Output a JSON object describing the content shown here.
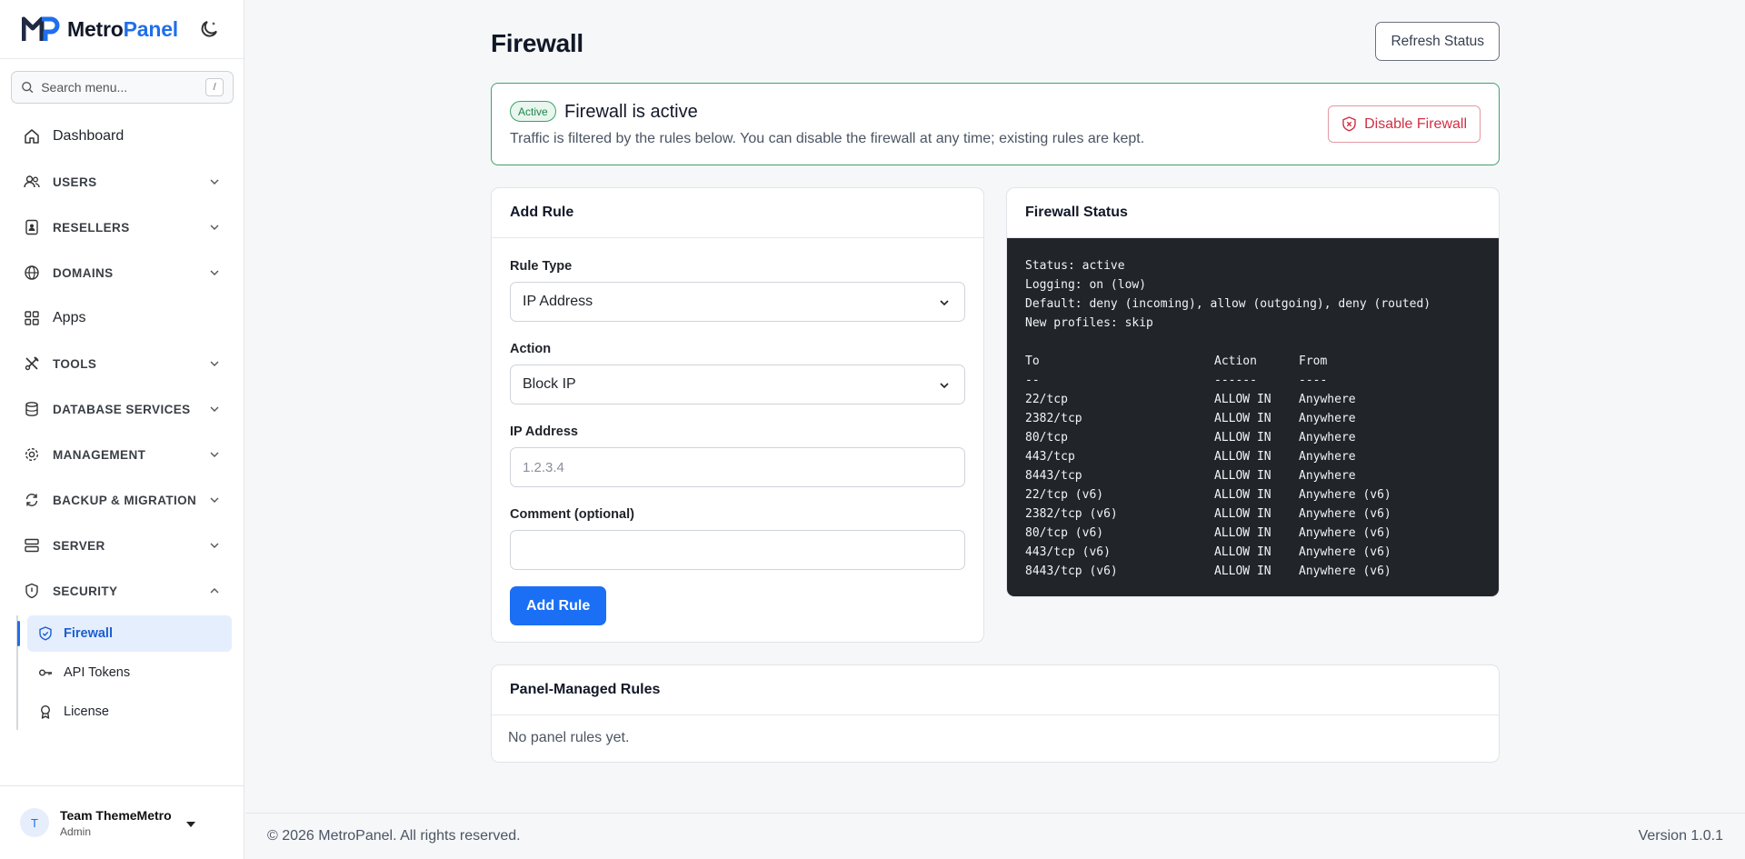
{
  "brand": {
    "name_part1": "Metro",
    "name_part2": "Panel"
  },
  "search": {
    "placeholder": "Search menu...",
    "shortcut": "/"
  },
  "nav": {
    "dashboard": "Dashboard",
    "users": "USERS",
    "resellers": "RESELLERS",
    "domains": "DOMAINS",
    "apps": "Apps",
    "tools": "TOOLS",
    "database_services": "DATABASE SERVICES",
    "management": "MANAGEMENT",
    "backup_migration": "BACKUP & MIGRATION",
    "server": "SERVER",
    "security": "SECURITY",
    "security_items": {
      "firewall": "Firewall",
      "api_tokens": "API Tokens",
      "license": "License"
    }
  },
  "user": {
    "initial": "T",
    "name": "Team ThemeMetro",
    "role": "Admin"
  },
  "page": {
    "title": "Firewall",
    "refresh_label": "Refresh Status"
  },
  "alert": {
    "badge": "Active",
    "title": "Firewall is active",
    "text": "Traffic is filtered by the rules below. You can disable the firewall at any time; existing rules are kept.",
    "disable_label": "Disable Firewall"
  },
  "add_rule": {
    "title": "Add Rule",
    "rule_type_label": "Rule Type",
    "rule_type_value": "IP Address",
    "action_label": "Action",
    "action_value": "Block IP",
    "ip_label": "IP Address",
    "ip_placeholder": "1.2.3.4",
    "comment_label": "Comment (optional)",
    "submit_label": "Add Rule"
  },
  "status_card": {
    "title": "Firewall Status",
    "header_lines": [
      "Status: active",
      "Logging: on (low)",
      "Default: deny (incoming), allow (outgoing), deny (routed)",
      "New profiles: skip"
    ],
    "columns": [
      "To",
      "Action",
      "From"
    ],
    "separators": [
      "--",
      "------",
      "----"
    ],
    "rules": [
      {
        "to": "22/tcp",
        "action": "ALLOW IN",
        "from": "Anywhere"
      },
      {
        "to": "2382/tcp",
        "action": "ALLOW IN",
        "from": "Anywhere"
      },
      {
        "to": "80/tcp",
        "action": "ALLOW IN",
        "from": "Anywhere"
      },
      {
        "to": "443/tcp",
        "action": "ALLOW IN",
        "from": "Anywhere"
      },
      {
        "to": "8443/tcp",
        "action": "ALLOW IN",
        "from": "Anywhere"
      },
      {
        "to": "22/tcp (v6)",
        "action": "ALLOW IN",
        "from": "Anywhere (v6)"
      },
      {
        "to": "2382/tcp (v6)",
        "action": "ALLOW IN",
        "from": "Anywhere (v6)"
      },
      {
        "to": "80/tcp (v6)",
        "action": "ALLOW IN",
        "from": "Anywhere (v6)"
      },
      {
        "to": "443/tcp (v6)",
        "action": "ALLOW IN",
        "from": "Anywhere (v6)"
      },
      {
        "to": "8443/tcp (v6)",
        "action": "ALLOW IN",
        "from": "Anywhere (v6)"
      }
    ]
  },
  "managed": {
    "title": "Panel-Managed Rules",
    "empty_text": "No panel rules yet."
  },
  "footer": {
    "copyright": "© 2026 MetroPanel. All rights reserved.",
    "version": "Version 1.0.1"
  },
  "colors": {
    "accent": "#1f6feb",
    "success": "#3fa16a",
    "danger": "#d12f44",
    "terminal_bg": "#212429"
  }
}
